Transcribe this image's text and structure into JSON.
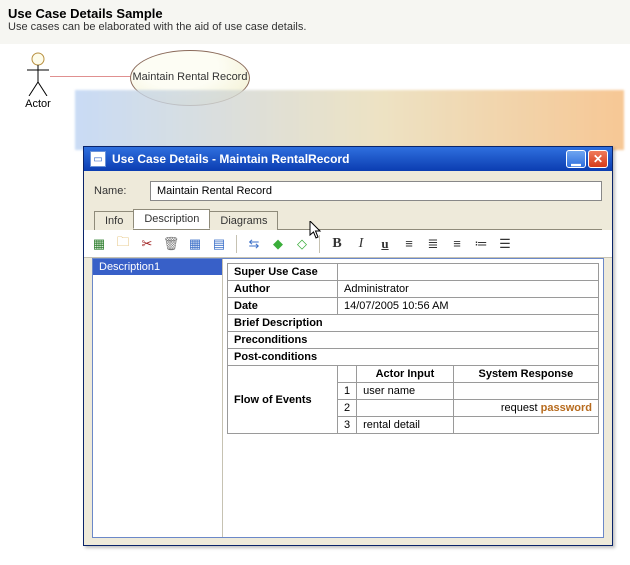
{
  "header": {
    "title": "Use Case Details Sample",
    "subtitle": "Use cases can be elaborated with the aid of use case details."
  },
  "diagram": {
    "actor_label": "Actor",
    "usecase_label": "Maintain Rental Record"
  },
  "window": {
    "title": "Use Case Details - Maintain RentalRecord",
    "name_label": "Name:",
    "name_value": "Maintain Rental Record",
    "tabs": [
      "Info",
      "Description",
      "Diagrams"
    ],
    "active_tab": 1,
    "tree_item": "Description1",
    "props": {
      "super_use_case_label": "Super Use Case",
      "super_use_case_value": "",
      "author_label": "Author",
      "author_value": "Administrator",
      "date_label": "Date",
      "date_value": "14/07/2005 10:56 AM",
      "brief_desc_label": "Brief Description",
      "preconditions_label": "Preconditions",
      "postconditions_label": "Post-conditions",
      "flow_label": "Flow of Events",
      "col_actor": "Actor Input",
      "col_system": "System Response",
      "rows": [
        {
          "n": "1",
          "actor": "user name",
          "system": ""
        },
        {
          "n": "2",
          "actor": "",
          "system_prefix": "request ",
          "system_strong": "password"
        },
        {
          "n": "3",
          "actor": "rental detail",
          "system": ""
        }
      ]
    }
  }
}
